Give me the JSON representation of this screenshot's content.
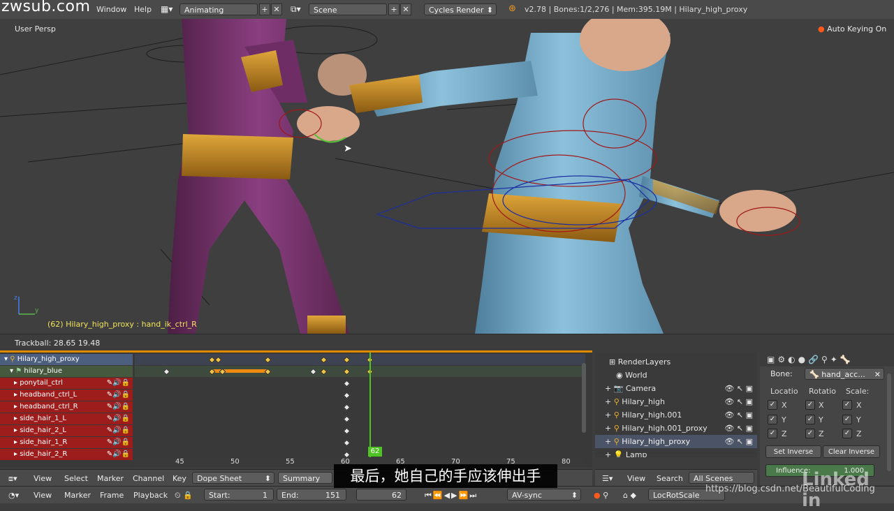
{
  "watermark_top": "zwsub.com",
  "topbar": {
    "window_menu": "Window",
    "help_menu": "Help",
    "screen_layout": "Animating",
    "scene": "Scene",
    "render_engine": "Cycles Render",
    "status": "v2.78 | Bones:1/2,276 | Mem:395.19M | Hilary_high_proxy"
  },
  "viewport": {
    "view_label": "User Persp",
    "auto_keying": "Auto Keying On",
    "active_info": "(62) Hilary_high_proxy : hand_ik_ctrl_R",
    "trackball": "Trackball: 28.65 19.48"
  },
  "dopesheet": {
    "channels": [
      {
        "label": "Hilary_high_proxy",
        "kind": "top"
      },
      {
        "label": "hilary_blue",
        "kind": "action"
      },
      {
        "label": "ponytail_ctrl",
        "kind": "bone"
      },
      {
        "label": "headband_ctrl_L",
        "kind": "bone"
      },
      {
        "label": "headband_ctrl_R",
        "kind": "bone"
      },
      {
        "label": "side_hair_1_L",
        "kind": "bone"
      },
      {
        "label": "side_hair_2_L",
        "kind": "bone"
      },
      {
        "label": "side_hair_1_R",
        "kind": "bone"
      },
      {
        "label": "side_hair_2_R",
        "kind": "bone"
      }
    ],
    "ruler_ticks": [
      "45",
      "50",
      "55",
      "60",
      "65",
      "70",
      "75",
      "80"
    ],
    "current_frame": "62",
    "header": {
      "view": "View",
      "select": "Select",
      "marker": "Marker",
      "channel": "Channel",
      "key": "Key",
      "mode": "Dope Sheet",
      "summary": "Summary"
    }
  },
  "outliner": {
    "items": [
      {
        "label": "RenderLayers",
        "icon": "render-layers-icon"
      },
      {
        "label": "World",
        "icon": "world-icon"
      },
      {
        "label": "Camera",
        "icon": "camera-icon"
      },
      {
        "label": "Hilary_high",
        "icon": "armature-icon"
      },
      {
        "label": "Hilary_high.001",
        "icon": "armature-icon"
      },
      {
        "label": "Hilary_high.001_proxy",
        "icon": "armature-icon"
      },
      {
        "label": "Hilary_high_proxy",
        "icon": "armature-icon"
      },
      {
        "label": "Lamp",
        "icon": "lamp-icon"
      }
    ],
    "header": {
      "view": "View",
      "search": "Search",
      "filter": "All Scenes"
    }
  },
  "properties": {
    "bone_label": "Bone:",
    "bone_value": "hand_acc...",
    "col_location": "Locatio",
    "col_rotation": "Rotatio",
    "col_scale": "Scale:",
    "axes": [
      "X",
      "Y",
      "Z"
    ],
    "set_inverse": "Set Inverse",
    "clear_inverse": "Clear Inverse",
    "influence_label": "Influence:",
    "influence_value": "1.000"
  },
  "timeline": {
    "view": "View",
    "marker": "Marker",
    "frame": "Frame",
    "playback": "Playback",
    "start_label": "Start:",
    "start_value": "1",
    "end_label": "End:",
    "end_value": "151",
    "current": "62",
    "sync": "AV-sync",
    "keying_set": "LocRotScale"
  },
  "subtitle": "最后，她自己的手应该伸出手",
  "watermark_bottom": "https://blog.csdn.net/BeautifulCoding",
  "linkedin": "Linked in",
  "colors": {
    "accent": "#e08a00",
    "bone_channel": "#9d1d1d",
    "current_frame": "#4fc224"
  }
}
